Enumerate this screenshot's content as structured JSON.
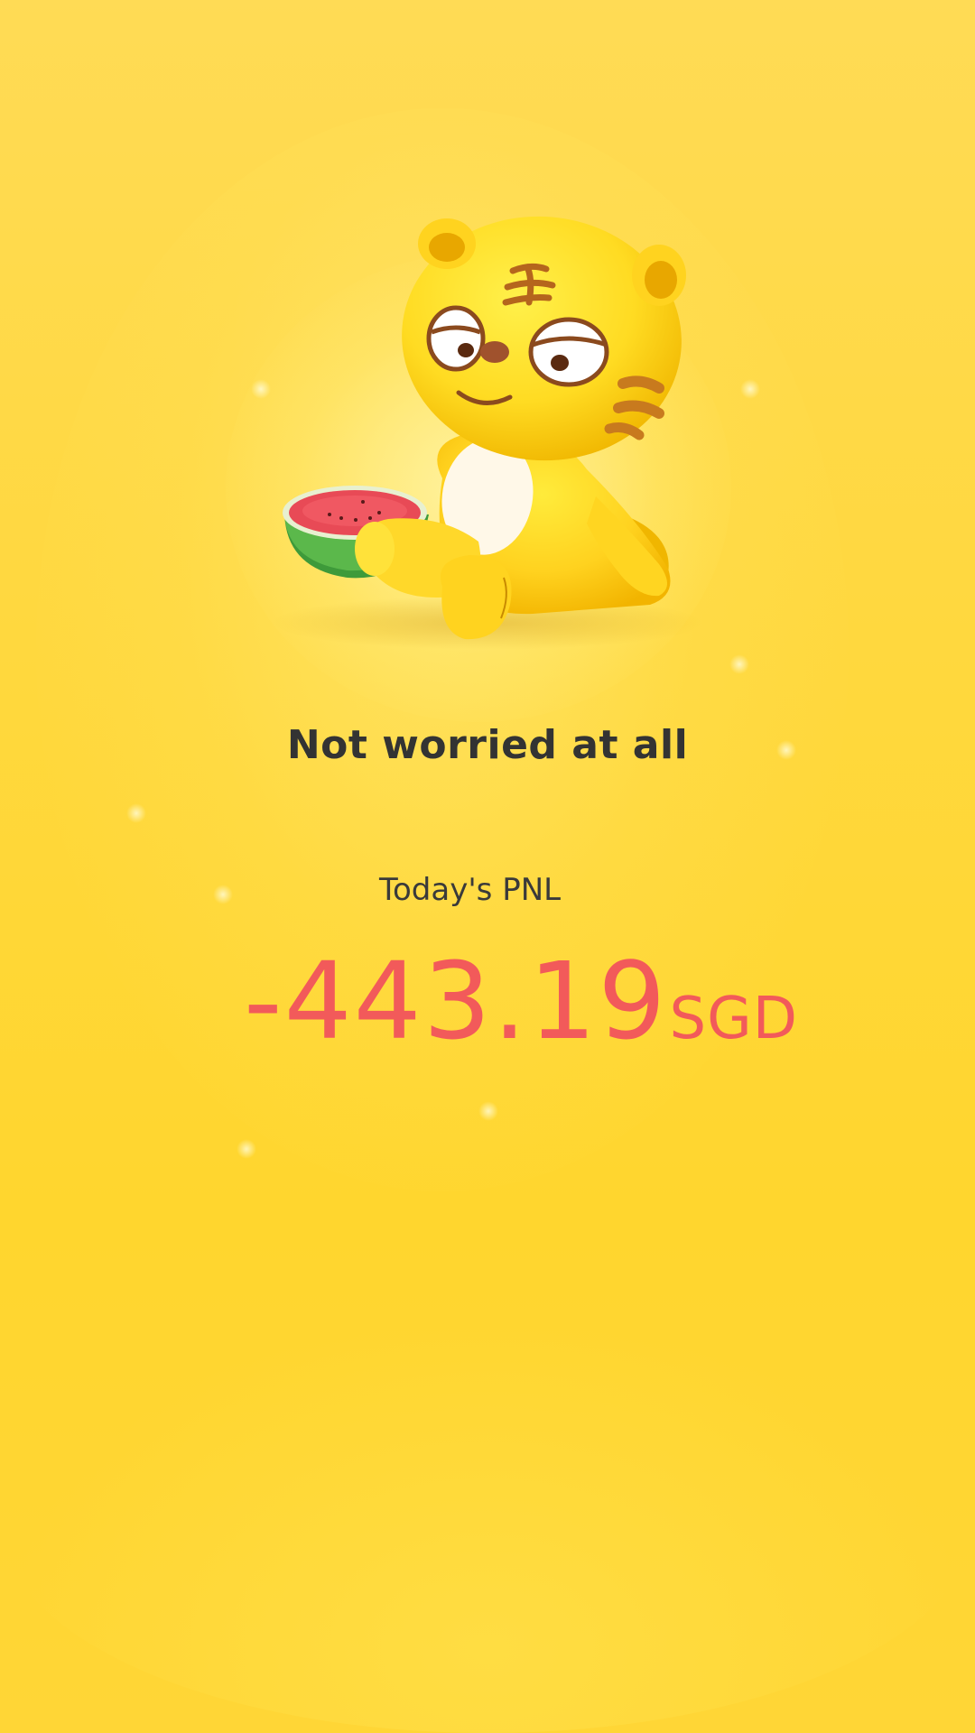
{
  "screen": {
    "headline": "Not worried at all",
    "pnl_label": "Today's PNL",
    "pnl_value": "-443.19",
    "pnl_currency": "SGD"
  },
  "mascot": {
    "icon": "tiger-mascot-with-watermelon-icon"
  },
  "colors": {
    "background": "#FFD83F",
    "headline_text": "#333333",
    "loss_value": "#F25A5A"
  }
}
